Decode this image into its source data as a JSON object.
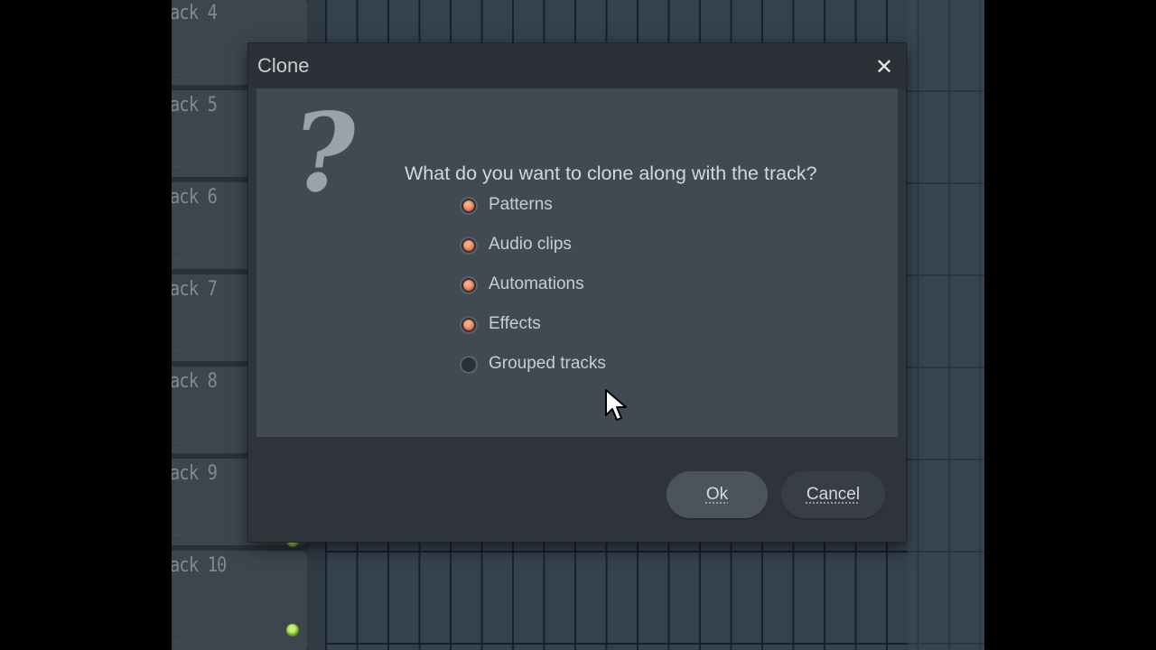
{
  "background": {
    "tracks": [
      {
        "label": "ack 4"
      },
      {
        "label": "ack 5"
      },
      {
        "label": "ack 6"
      },
      {
        "label": "ack 7"
      },
      {
        "label": "ack 8"
      },
      {
        "label": "ack 9"
      },
      {
        "label": "ack 10"
      }
    ]
  },
  "dialog": {
    "title": "Clone",
    "close_icon": "close-icon",
    "question_icon": "question-icon",
    "prompt": "What do you want to clone along with the track?",
    "options": [
      {
        "label": "Patterns",
        "checked": true
      },
      {
        "label": "Audio clips",
        "checked": true
      },
      {
        "label": "Automations",
        "checked": true
      },
      {
        "label": "Effects",
        "checked": true
      },
      {
        "label": "Grouped tracks",
        "checked": false
      }
    ],
    "buttons": {
      "ok": "Ok",
      "cancel": "Cancel"
    }
  },
  "colors": {
    "accent": "#f07a4a",
    "led": "#8ccf34"
  }
}
